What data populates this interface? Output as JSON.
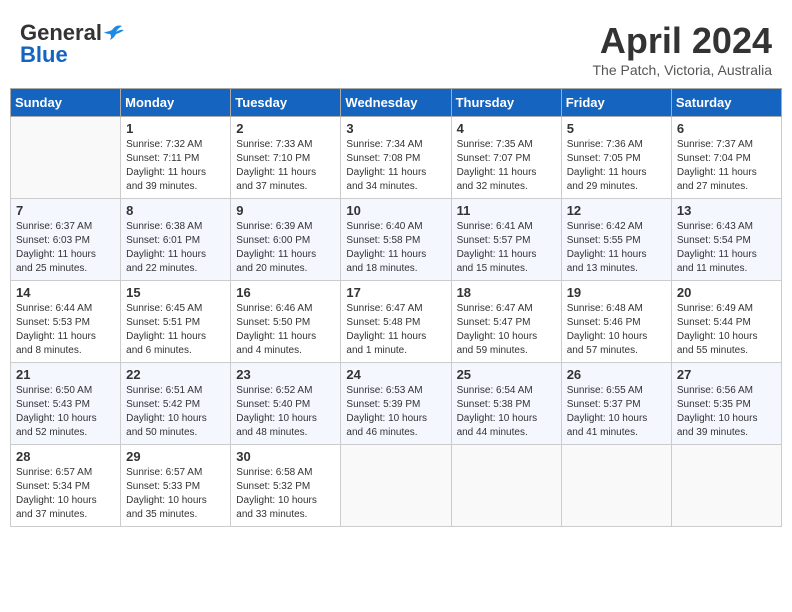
{
  "header": {
    "logo_line1": "General",
    "logo_line2": "Blue",
    "month_year": "April 2024",
    "location": "The Patch, Victoria, Australia"
  },
  "days_of_week": [
    "Sunday",
    "Monday",
    "Tuesday",
    "Wednesday",
    "Thursday",
    "Friday",
    "Saturday"
  ],
  "weeks": [
    [
      {
        "day": "",
        "sunrise": "",
        "sunset": "",
        "daylight": ""
      },
      {
        "day": "1",
        "sunrise": "Sunrise: 7:32 AM",
        "sunset": "Sunset: 7:11 PM",
        "daylight": "Daylight: 11 hours and 39 minutes."
      },
      {
        "day": "2",
        "sunrise": "Sunrise: 7:33 AM",
        "sunset": "Sunset: 7:10 PM",
        "daylight": "Daylight: 11 hours and 37 minutes."
      },
      {
        "day": "3",
        "sunrise": "Sunrise: 7:34 AM",
        "sunset": "Sunset: 7:08 PM",
        "daylight": "Daylight: 11 hours and 34 minutes."
      },
      {
        "day": "4",
        "sunrise": "Sunrise: 7:35 AM",
        "sunset": "Sunset: 7:07 PM",
        "daylight": "Daylight: 11 hours and 32 minutes."
      },
      {
        "day": "5",
        "sunrise": "Sunrise: 7:36 AM",
        "sunset": "Sunset: 7:05 PM",
        "daylight": "Daylight: 11 hours and 29 minutes."
      },
      {
        "day": "6",
        "sunrise": "Sunrise: 7:37 AM",
        "sunset": "Sunset: 7:04 PM",
        "daylight": "Daylight: 11 hours and 27 minutes."
      }
    ],
    [
      {
        "day": "7",
        "sunrise": "Sunrise: 6:37 AM",
        "sunset": "Sunset: 6:03 PM",
        "daylight": "Daylight: 11 hours and 25 minutes."
      },
      {
        "day": "8",
        "sunrise": "Sunrise: 6:38 AM",
        "sunset": "Sunset: 6:01 PM",
        "daylight": "Daylight: 11 hours and 22 minutes."
      },
      {
        "day": "9",
        "sunrise": "Sunrise: 6:39 AM",
        "sunset": "Sunset: 6:00 PM",
        "daylight": "Daylight: 11 hours and 20 minutes."
      },
      {
        "day": "10",
        "sunrise": "Sunrise: 6:40 AM",
        "sunset": "Sunset: 5:58 PM",
        "daylight": "Daylight: 11 hours and 18 minutes."
      },
      {
        "day": "11",
        "sunrise": "Sunrise: 6:41 AM",
        "sunset": "Sunset: 5:57 PM",
        "daylight": "Daylight: 11 hours and 15 minutes."
      },
      {
        "day": "12",
        "sunrise": "Sunrise: 6:42 AM",
        "sunset": "Sunset: 5:55 PM",
        "daylight": "Daylight: 11 hours and 13 minutes."
      },
      {
        "day": "13",
        "sunrise": "Sunrise: 6:43 AM",
        "sunset": "Sunset: 5:54 PM",
        "daylight": "Daylight: 11 hours and 11 minutes."
      }
    ],
    [
      {
        "day": "14",
        "sunrise": "Sunrise: 6:44 AM",
        "sunset": "Sunset: 5:53 PM",
        "daylight": "Daylight: 11 hours and 8 minutes."
      },
      {
        "day": "15",
        "sunrise": "Sunrise: 6:45 AM",
        "sunset": "Sunset: 5:51 PM",
        "daylight": "Daylight: 11 hours and 6 minutes."
      },
      {
        "day": "16",
        "sunrise": "Sunrise: 6:46 AM",
        "sunset": "Sunset: 5:50 PM",
        "daylight": "Daylight: 11 hours and 4 minutes."
      },
      {
        "day": "17",
        "sunrise": "Sunrise: 6:47 AM",
        "sunset": "Sunset: 5:48 PM",
        "daylight": "Daylight: 11 hours and 1 minute."
      },
      {
        "day": "18",
        "sunrise": "Sunrise: 6:47 AM",
        "sunset": "Sunset: 5:47 PM",
        "daylight": "Daylight: 10 hours and 59 minutes."
      },
      {
        "day": "19",
        "sunrise": "Sunrise: 6:48 AM",
        "sunset": "Sunset: 5:46 PM",
        "daylight": "Daylight: 10 hours and 57 minutes."
      },
      {
        "day": "20",
        "sunrise": "Sunrise: 6:49 AM",
        "sunset": "Sunset: 5:44 PM",
        "daylight": "Daylight: 10 hours and 55 minutes."
      }
    ],
    [
      {
        "day": "21",
        "sunrise": "Sunrise: 6:50 AM",
        "sunset": "Sunset: 5:43 PM",
        "daylight": "Daylight: 10 hours and 52 minutes."
      },
      {
        "day": "22",
        "sunrise": "Sunrise: 6:51 AM",
        "sunset": "Sunset: 5:42 PM",
        "daylight": "Daylight: 10 hours and 50 minutes."
      },
      {
        "day": "23",
        "sunrise": "Sunrise: 6:52 AM",
        "sunset": "Sunset: 5:40 PM",
        "daylight": "Daylight: 10 hours and 48 minutes."
      },
      {
        "day": "24",
        "sunrise": "Sunrise: 6:53 AM",
        "sunset": "Sunset: 5:39 PM",
        "daylight": "Daylight: 10 hours and 46 minutes."
      },
      {
        "day": "25",
        "sunrise": "Sunrise: 6:54 AM",
        "sunset": "Sunset: 5:38 PM",
        "daylight": "Daylight: 10 hours and 44 minutes."
      },
      {
        "day": "26",
        "sunrise": "Sunrise: 6:55 AM",
        "sunset": "Sunset: 5:37 PM",
        "daylight": "Daylight: 10 hours and 41 minutes."
      },
      {
        "day": "27",
        "sunrise": "Sunrise: 6:56 AM",
        "sunset": "Sunset: 5:35 PM",
        "daylight": "Daylight: 10 hours and 39 minutes."
      }
    ],
    [
      {
        "day": "28",
        "sunrise": "Sunrise: 6:57 AM",
        "sunset": "Sunset: 5:34 PM",
        "daylight": "Daylight: 10 hours and 37 minutes."
      },
      {
        "day": "29",
        "sunrise": "Sunrise: 6:57 AM",
        "sunset": "Sunset: 5:33 PM",
        "daylight": "Daylight: 10 hours and 35 minutes."
      },
      {
        "day": "30",
        "sunrise": "Sunrise: 6:58 AM",
        "sunset": "Sunset: 5:32 PM",
        "daylight": "Daylight: 10 hours and 33 minutes."
      },
      {
        "day": "",
        "sunrise": "",
        "sunset": "",
        "daylight": ""
      },
      {
        "day": "",
        "sunrise": "",
        "sunset": "",
        "daylight": ""
      },
      {
        "day": "",
        "sunrise": "",
        "sunset": "",
        "daylight": ""
      },
      {
        "day": "",
        "sunrise": "",
        "sunset": "",
        "daylight": ""
      }
    ]
  ]
}
